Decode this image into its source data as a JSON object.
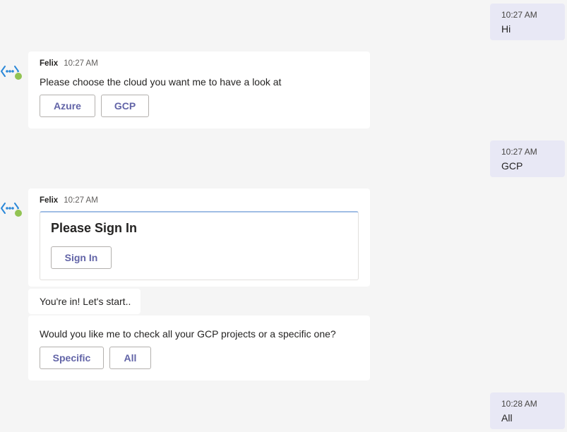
{
  "messages": {
    "me1": {
      "time": "10:27 AM",
      "text": "Hi"
    },
    "bot1": {
      "sender": "Felix",
      "time": "10:27 AM",
      "text": "Please choose the cloud you want me to have a look at",
      "buttons": [
        "Azure",
        "GCP"
      ]
    },
    "me2": {
      "time": "10:27 AM",
      "text": "GCP"
    },
    "bot2": {
      "sender": "Felix",
      "time": "10:27 AM",
      "card_title": "Please Sign In",
      "card_button": "Sign In",
      "followup": "You're in! Let's start..",
      "question": "Would you like me to check all your GCP projects or a specific one?",
      "buttons": [
        "Specific",
        "All"
      ]
    },
    "me3": {
      "time": "10:28 AM",
      "text": "All"
    }
  },
  "icons": {
    "avatar": "bot-avatar-icon",
    "status": "online-status-icon"
  },
  "colors": {
    "accent": "#6264a7",
    "my_bubble": "#e8e8f5",
    "status_online": "#92c353",
    "background": "#f5f5f5"
  }
}
